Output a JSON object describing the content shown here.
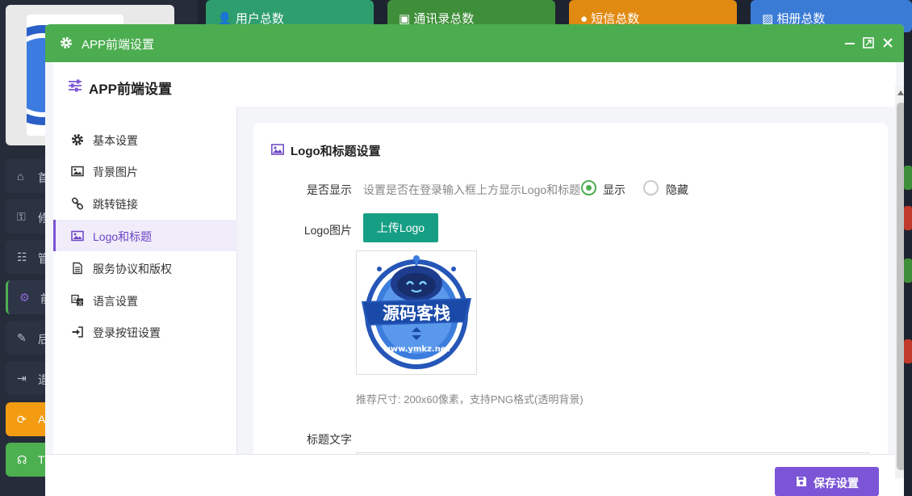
{
  "background": {
    "cards": [
      {
        "label": "用户总数",
        "color": "#2e9e6e"
      },
      {
        "label": "通讯录总数",
        "color": "#3f8f3a"
      },
      {
        "label": "短信总数",
        "color": "#e08a12"
      },
      {
        "label": "相册总数",
        "color": "#3a7bd5"
      }
    ],
    "nav": [
      {
        "label": "首"
      },
      {
        "label": "修"
      },
      {
        "label": "管"
      },
      {
        "label": "前"
      },
      {
        "label": "后"
      },
      {
        "label": "退"
      },
      {
        "label": "A"
      },
      {
        "label": "T"
      }
    ]
  },
  "modal": {
    "title": "APP前端设置",
    "header": "APP前端设置",
    "menu": [
      {
        "label": "基本设置",
        "icon": "gear-icon"
      },
      {
        "label": "背景图片",
        "icon": "image-icon"
      },
      {
        "label": "跳转链接",
        "icon": "link-icon"
      },
      {
        "label": "Logo和标题",
        "icon": "image-icon"
      },
      {
        "label": "服务协议和版权",
        "icon": "document-icon"
      },
      {
        "label": "语言设置",
        "icon": "translate-icon"
      },
      {
        "label": "登录按钮设置",
        "icon": "sign-in-icon"
      }
    ],
    "section_title": "Logo和标题设置",
    "show_label": "是否显示",
    "show_hint": "设置是否在登录输入框上方显示Logo和标题",
    "radio_show": "显示",
    "radio_hide": "隐藏",
    "logo_label": "Logo图片",
    "upload_label": "上传Logo",
    "logo_text": "源码客栈",
    "logo_url": "www.ymkz.net",
    "size_hint": "推荐尺寸: 200x60像素，支持PNG格式(透明背景)",
    "title_label": "标题文字",
    "save_label": "保存设置"
  },
  "colors": {
    "titlebar": "#4cad50",
    "accent": "#7b55d6",
    "upload": "#179f85"
  }
}
